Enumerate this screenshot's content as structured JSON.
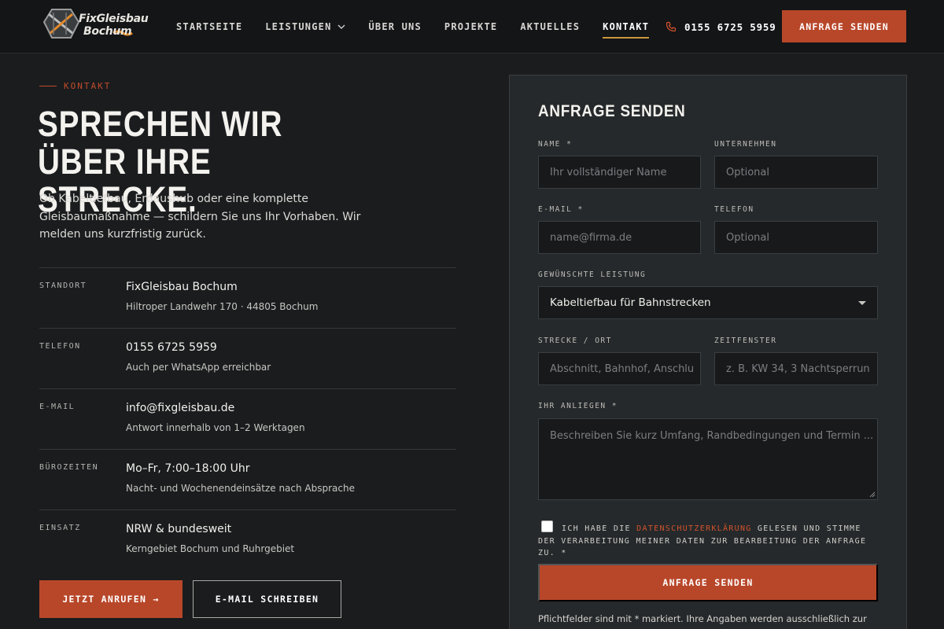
{
  "header": {
    "logo_line1": "FixGleisbau",
    "logo_line2": "Bochum",
    "nav": [
      {
        "label": "STARTSEITE"
      },
      {
        "label": "LEISTUNGEN"
      },
      {
        "label": "ÜBER UNS"
      },
      {
        "label": "PROJEKTE"
      },
      {
        "label": "AKTUELLES"
      },
      {
        "label": "KONTAKT"
      }
    ],
    "active_nav": "KONTAKT",
    "phone": "0155 6725 5959",
    "cta": "ANFRAGE SENDEN"
  },
  "hero": {
    "eyebrow": "KONTAKT",
    "heading": "SPRECHEN WIR ÜBER IHRE STRECKE.",
    "intro": "Ob Kabeltiefbau, Erdaushub oder eine komplette Gleisbaumaßnahme — schildern Sie uns Ihr Vorhaben. Wir melden uns kurzfristig zurück."
  },
  "info": [
    {
      "label": "STANDORT",
      "value": "FixGleisbau Bochum",
      "sub": "Hiltroper Landwehr 170 · 44805 Bochum"
    },
    {
      "label": "TELEFON",
      "value": "0155 6725 5959",
      "sub": "Auch per WhatsApp erreichbar"
    },
    {
      "label": "E-MAIL",
      "value": "info@fixgleisbau.de",
      "sub": "Antwort innerhalb von 1–2 Werktagen"
    },
    {
      "label": "BÜROZEITEN",
      "value": "Mo–Fr, 7:00–18:00 Uhr",
      "sub": "Nacht- und Wochenendeinsätze nach Absprache"
    },
    {
      "label": "EINSATZ",
      "value": "NRW & bundesweit",
      "sub": "Kerngebiet Bochum und Ruhrgebiet"
    }
  ],
  "buttons": {
    "call": "JETZT ANRUFEN →",
    "mail": "E-MAIL SCHREIBEN"
  },
  "form": {
    "title": "ANFRAGE SENDEN",
    "name_label": "NAME *",
    "name_placeholder": "Ihr vollständiger Name",
    "company_label": "UNTERNEHMEN",
    "company_placeholder": "Optional",
    "email_label": "E-MAIL *",
    "email_placeholder": "name@firma.de",
    "phone_label": "TELEFON",
    "phone_placeholder": "Optional",
    "service_label": "GEWÜNSCHTE LEISTUNG",
    "service_value": "Kabeltiefbau für Bahnstrecken",
    "route_label": "STRECKE / ORT",
    "route_placeholder": "Abschnitt, Bahnhof, Anschlu",
    "time_label": "ZEITFENSTER",
    "time_placeholder": "z. B. KW 34, 3 Nachtsperrun",
    "message_label": "IHR ANLIEGEN *",
    "message_placeholder": "Beschreiben Sie kurz Umfang, Randbedingungen und Termin ...",
    "consent_pre": "ICH HABE DIE ",
    "consent_link": "DATENSCHUTZERKLÄRUNG",
    "consent_post": " GELESEN UND STIMME DER VERARBEITUNG MEINER DATEN ZUR BEARBEITUNG DER ANFRAGE ZU. *",
    "submit": "ANFRAGE SENDEN",
    "footnote": "Pflichtfelder sind mit * markiert. Ihre Angaben werden ausschließlich zur"
  },
  "colors": {
    "accent": "#b8472a",
    "nav_underline": "#c9973a",
    "background": "#1a1c1e",
    "panel": "#25292b"
  }
}
